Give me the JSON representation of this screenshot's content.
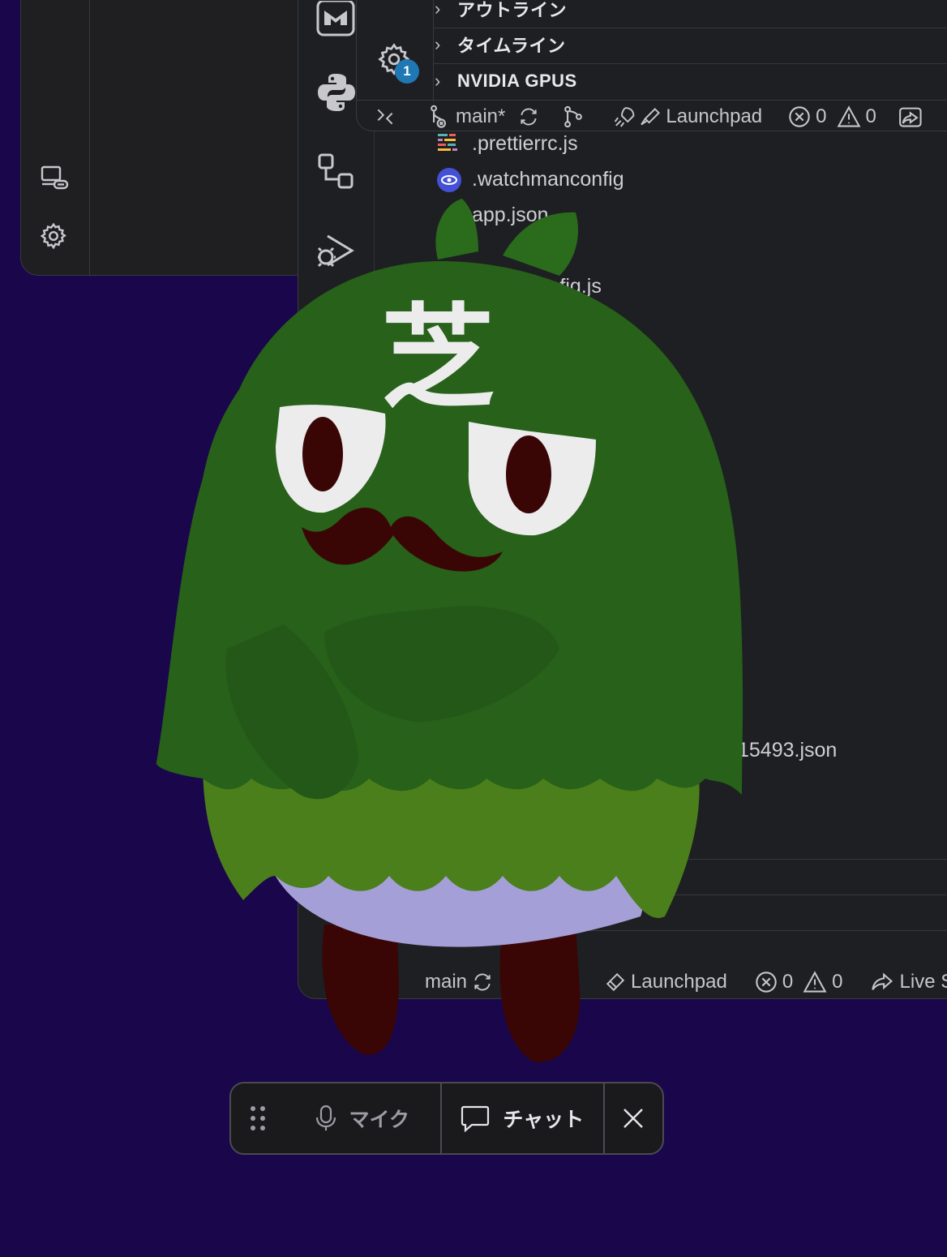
{
  "left_window": {
    "icons": [
      "remote-link-icon",
      "gear-icon"
    ]
  },
  "front_panel": {
    "sections": [
      {
        "label": "アウトライン"
      },
      {
        "label": "タイムライン"
      },
      {
        "label": "NVIDIA GPUS"
      }
    ],
    "settings_badge": "1",
    "status": {
      "branch": "main*",
      "launchpad": "Launchpad",
      "errors": "0",
      "warnings": "0"
    }
  },
  "explorer": {
    "files": [
      {
        "name": ".prettierrc.js",
        "icon": "prettier-icon"
      },
      {
        "name": ".watchmanconfig",
        "icon": "watchman-icon"
      },
      {
        "name": "app.json",
        "icon": ""
      },
      {
        "name": "babel.config.js",
        "icon": ""
      }
    ],
    "partial_file": "15493.json"
  },
  "back_status": {
    "branch": "main",
    "launchpad": "Launchpad",
    "errors": "0",
    "warnings": "0",
    "live_share": "Live Sh"
  },
  "mascot": {
    "kanji": "芝"
  },
  "control_bar": {
    "drag_icon": "drag-handle-icon",
    "mic_label": "マイク",
    "chat_label": "チャット",
    "close_icon": "close-icon"
  },
  "colors": {
    "desktop": "#1a064a",
    "mascot_green_dark": "#27611a",
    "mascot_green_light": "#4b7f1b",
    "mascot_belly": "#a59fd8",
    "accent_badge": "#1f78b4"
  }
}
